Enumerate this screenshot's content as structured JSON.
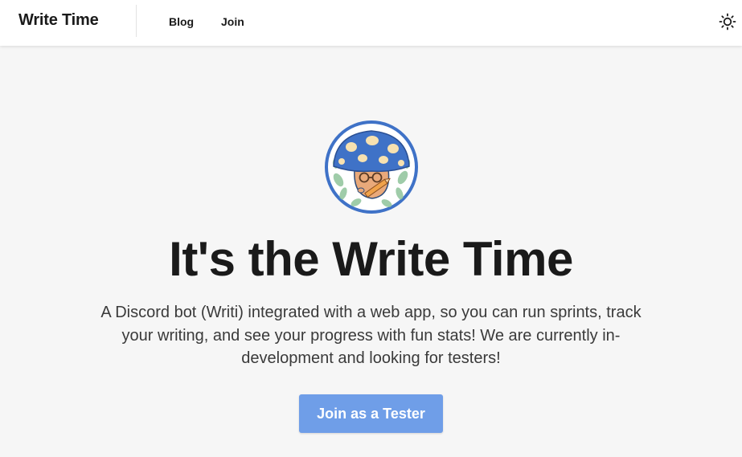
{
  "header": {
    "brand": "Write Time",
    "nav": [
      {
        "label": "Blog"
      },
      {
        "label": "Join"
      }
    ],
    "theme_toggle_icon": "sun-icon"
  },
  "hero": {
    "logo_icon": "mushroom-mascot-logo",
    "title": "It's the Write Time",
    "description": "A Discord bot (Writi) integrated with a web app, so you can run sprints, track your writing, and see your progress with fun stats! We are currently in-development and looking for testers!",
    "cta_label": "Join as a Tester"
  },
  "colors": {
    "background": "#f6f6f6",
    "header_bg": "#ffffff",
    "accent": "#6f9ee8",
    "text": "#1a1a1a",
    "logo_blue": "#3f72c7",
    "logo_spots": "#f7e1b0",
    "logo_skin": "#e9a97a",
    "logo_leaves": "#8fc49a"
  }
}
